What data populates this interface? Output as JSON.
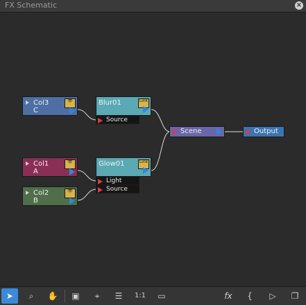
{
  "window": {
    "title": "FX Schematic",
    "close_icon": "close-icon"
  },
  "nodes": {
    "col3": {
      "name": "Col3",
      "sub": "C",
      "color": "#4e6fa3"
    },
    "col1": {
      "name": "Col1",
      "sub": "A",
      "color": "#8a2e56"
    },
    "col2": {
      "name": "Col2",
      "sub": "B",
      "color": "#4f6e49"
    },
    "blur": {
      "name": "Blur01",
      "ports": [
        "Source"
      ],
      "badge": "Link"
    },
    "glow": {
      "name": "Glow01",
      "ports": [
        "Light",
        "Source"
      ],
      "badge": "Link"
    },
    "scene": {
      "name": "Scene"
    },
    "output": {
      "name": "Output"
    }
  },
  "toolbar": {
    "items": [
      {
        "icon": "select-arrow-icon",
        "glyph": "➤"
      },
      {
        "icon": "zoom-icon",
        "glyph": "🔍"
      },
      {
        "icon": "hand-icon",
        "glyph": "✋"
      },
      {
        "icon": "fit-window-icon",
        "glyph": "▣"
      },
      {
        "icon": "focus-icon",
        "glyph": "⌖"
      },
      {
        "icon": "reorder-icon",
        "glyph": "☰"
      },
      {
        "icon": "actual-size-icon",
        "glyph": "1:1"
      },
      {
        "icon": "preview-icon",
        "glyph": "▭"
      },
      {
        "icon": "fx-icon",
        "glyph": "fx"
      },
      {
        "icon": "macro-icon",
        "glyph": "{"
      },
      {
        "icon": "play-icon",
        "glyph": "▷"
      },
      {
        "icon": "window-toggle-icon",
        "glyph": "❐"
      }
    ]
  }
}
